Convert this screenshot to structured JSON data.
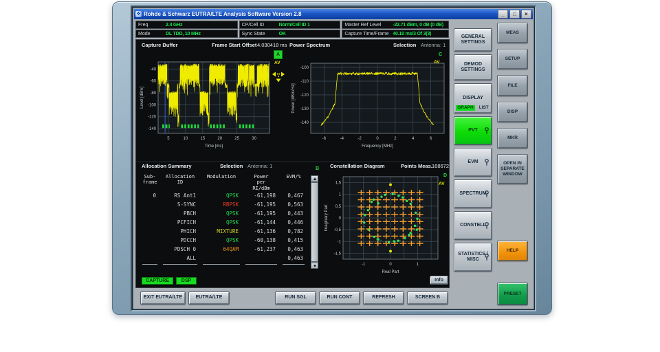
{
  "window": {
    "title": "Rohde & Schwarz EUTRA/LTE Analysis Software Version 2.8",
    "logo_glyph": "❖",
    "controls": {
      "minimize": "_",
      "maximize": "□",
      "close": "×"
    }
  },
  "info_bar": {
    "rows": [
      {
        "cells": [
          {
            "label": "Freq",
            "value": "2.4 GHz"
          },
          {
            "label": "CP/Cell ID",
            "value": "Norm/Cell ID 1"
          },
          {
            "label": "Master Ref Level",
            "value": "-22.71 dBm, 0 dB (0 dB)"
          }
        ]
      },
      {
        "cells": [
          {
            "label": "Mode",
            "value": "DL TDD, 10 MHz"
          },
          {
            "label": "Sync State",
            "value": "OK"
          },
          {
            "label": "Capture Time/Frame",
            "value": "40.10 ms/3 Of 3(3)"
          }
        ]
      }
    ]
  },
  "capture_buffer": {
    "title": "Capture Buffer",
    "offset_label": "Frame Start Offset",
    "offset_value": "4.030418 ms",
    "screen_badge": "A",
    "trace_label": "AV",
    "chart": {
      "type": "line",
      "xlabel": "Time [ms]",
      "ylabel": "Level [dBm]",
      "xticks": [
        5,
        10,
        15,
        20,
        25,
        30
      ],
      "yticks": [
        -40,
        -60,
        -80,
        -100,
        -120,
        -140
      ],
      "xmin": 2,
      "xmax": 34.5,
      "ymin": -148,
      "ymax": -28,
      "trace_color": "#f0ec00",
      "marker_time": 4.030418,
      "marker_color": "#3e5fd6",
      "high_bursts": [
        [
          2,
          4.6
        ],
        [
          8.4,
          14.0
        ],
        [
          16.9,
          21.5
        ],
        [
          25.3,
          30.1
        ],
        [
          30.9,
          34.3
        ]
      ],
      "low_bursts": [
        [
          5.2,
          7.6
        ],
        [
          14.2,
          16.6
        ],
        [
          22.2,
          24.7
        ]
      ],
      "notch_times": [
        7.9,
        16.75,
        24.85
      ],
      "green_bars": [
        [
          3.2,
          5.4
        ],
        [
          8.7,
          13.9
        ],
        [
          17.1,
          21.7
        ],
        [
          25.6,
          30.1
        ]
      ],
      "green_bar_color": "#1fd83a"
    }
  },
  "power_spectrum": {
    "title": "Power Spectrum",
    "selection_label": "Selection",
    "selection_value": "Antenna: 1",
    "screen_badge": "C",
    "trace_label": "AV",
    "chart": {
      "type": "line",
      "xlabel": "Frequency [MHz]",
      "ylabel": "Power [dBm/Hz]",
      "xticks": [
        -6,
        -4,
        -2,
        0,
        2,
        4,
        6
      ],
      "yticks": [
        -100,
        -110,
        -120,
        -130,
        -140
      ],
      "xmin": -7.5,
      "xmax": 7.5,
      "ymin": -148,
      "ymax": -97,
      "flat_level": -104.5,
      "trace_color": "#f0ec00"
    }
  },
  "allocation_summary": {
    "title": "Allocation Summary",
    "selection_label": "Selection",
    "selection_value": "Antenna: 1",
    "screen_badge": "B",
    "table": {
      "headers": [
        "Sub-\nframe",
        "Allocation\nID",
        "Modulation",
        "Power\nper\nRE/dBm",
        "EVM/%"
      ],
      "modulation_colors": {
        "QPSK": "#25d551",
        "RBPSK": "#e83d26",
        "MIXTURE": "#d8d822",
        "64QAM": "#e78e14"
      },
      "rows": [
        {
          "subframe": "0",
          "id": "RS Ant1",
          "modulation": "QPSK",
          "power": "-61,198",
          "evm": "0,467"
        },
        {
          "subframe": "",
          "id": "S-SYNC",
          "modulation": "RBPSK",
          "power": "-61,195",
          "evm": "0,563"
        },
        {
          "subframe": "",
          "id": "PBCH",
          "modulation": "QPSK",
          "power": "-61,195",
          "evm": "0,443"
        },
        {
          "subframe": "",
          "id": "PCFICH",
          "modulation": "QPSK",
          "power": "-61,144",
          "evm": "0,446"
        },
        {
          "subframe": "",
          "id": "PHICH",
          "modulation": "MIXTURE",
          "power": "-61,136",
          "evm": "0,782"
        },
        {
          "subframe": "",
          "id": "PDCCH",
          "modulation": "QPSK",
          "power": "-60,138",
          "evm": "0,415"
        },
        {
          "subframe": "",
          "id": "PDSCH 0",
          "modulation": "64QAM",
          "power": "-61,237",
          "evm": "0,463"
        },
        {
          "subframe": "",
          "id": "ALL",
          "modulation": "",
          "power": "",
          "evm": "0,463"
        }
      ]
    }
  },
  "constellation": {
    "title": "Constellation Diagram",
    "points_label": "Points Meas.",
    "points_value": "168672",
    "screen_badge": "D",
    "trace_label": "AV",
    "chart": {
      "type": "scatter",
      "xlabel": "Real Part",
      "ylabel": "Imaginary Part",
      "xticks": [
        -1,
        0,
        1
      ],
      "xtick_labels": [
        "-1",
        "0",
        "1"
      ],
      "yticks": [
        1.5,
        1,
        0.5,
        0,
        -0.5,
        -1,
        -1.5
      ],
      "ytick_labels": [
        "1,5",
        "1",
        "0,5",
        "0",
        "-0,5",
        "-1",
        "-1,5"
      ],
      "xmin": -1.75,
      "xmax": 1.75,
      "ymin": -1.75,
      "ymax": 1.75,
      "grid_step": 0.5,
      "qam_levels": [
        0.1543,
        0.4629,
        0.7715,
        1.0801
      ],
      "qam_color": "#f59d2b",
      "ring_color": "#37e054",
      "ring_radius": 1.03,
      "minor_color": "#2ba39b",
      "ring_points": [
        [
          -0.2,
          0.98
        ],
        [
          0.08,
          1.01
        ],
        [
          0.3,
          0.94
        ],
        [
          -0.33,
          0.9
        ],
        [
          0.45,
          0.87
        ],
        [
          -0.45,
          0.62
        ],
        [
          -0.62,
          0.78
        ],
        [
          0.6,
          0.72
        ],
        [
          0.74,
          0.6
        ],
        [
          -0.83,
          0.33
        ],
        [
          -0.94,
          0.12
        ],
        [
          0.93,
          0.22
        ],
        [
          0.99,
          -0.04
        ],
        [
          -0.97,
          -0.2
        ],
        [
          0.9,
          -0.33
        ],
        [
          -0.81,
          -0.5
        ],
        [
          0.97,
          -0.5
        ],
        [
          0.74,
          -0.64
        ],
        [
          -0.6,
          -0.8
        ],
        [
          -0.45,
          -0.91
        ],
        [
          0.53,
          -0.86
        ],
        [
          0.28,
          -0.97
        ],
        [
          -0.06,
          -1.02
        ],
        [
          0.13,
          -0.99
        ],
        [
          -0.7,
          0.68
        ],
        [
          0.68,
          -0.72
        ]
      ],
      "marker_points": [
        [
          0,
          1.41
        ],
        [
          0,
          -1.41
        ]
      ],
      "marker_color": "#e8e400"
    }
  },
  "bottom_bar": {
    "status_badges": [
      "CAPTURE",
      "DSP"
    ],
    "info_button": "Info",
    "buttons": [
      "EXIT EUTRA/LTE",
      "EUTRA/LTE",
      "RUN SGL",
      "RUN CONT",
      "REFRESH",
      "SCREEN B"
    ]
  },
  "softkeys": [
    {
      "label": "GENERAL SETTINGS"
    },
    {
      "label": "DEMOD SETTINGS"
    },
    {
      "label": "DISPLAY",
      "toggles": [
        "GRAPH",
        "LIST"
      ],
      "active_toggle": "GRAPH"
    },
    {
      "label": "PVT",
      "active": true,
      "pin": true
    },
    {
      "label": "EVM",
      "pin": true
    },
    {
      "label": "SPECTRUM",
      "pin": true
    },
    {
      "label": "CONSTELL",
      "pin": true
    },
    {
      "label": "STATISTICS / MISC",
      "pin": true
    }
  ],
  "hardkeys": [
    {
      "label": "MEAS"
    },
    {
      "label": "SETUP"
    },
    {
      "label": "FILE"
    },
    {
      "label": "DISP"
    },
    {
      "label": "MKR"
    },
    {
      "label": "OPEN IN SEPARATE WINDOW"
    },
    {
      "label": "HELP",
      "color": "orange"
    },
    {
      "label": "PRESET",
      "color": "green"
    }
  ]
}
